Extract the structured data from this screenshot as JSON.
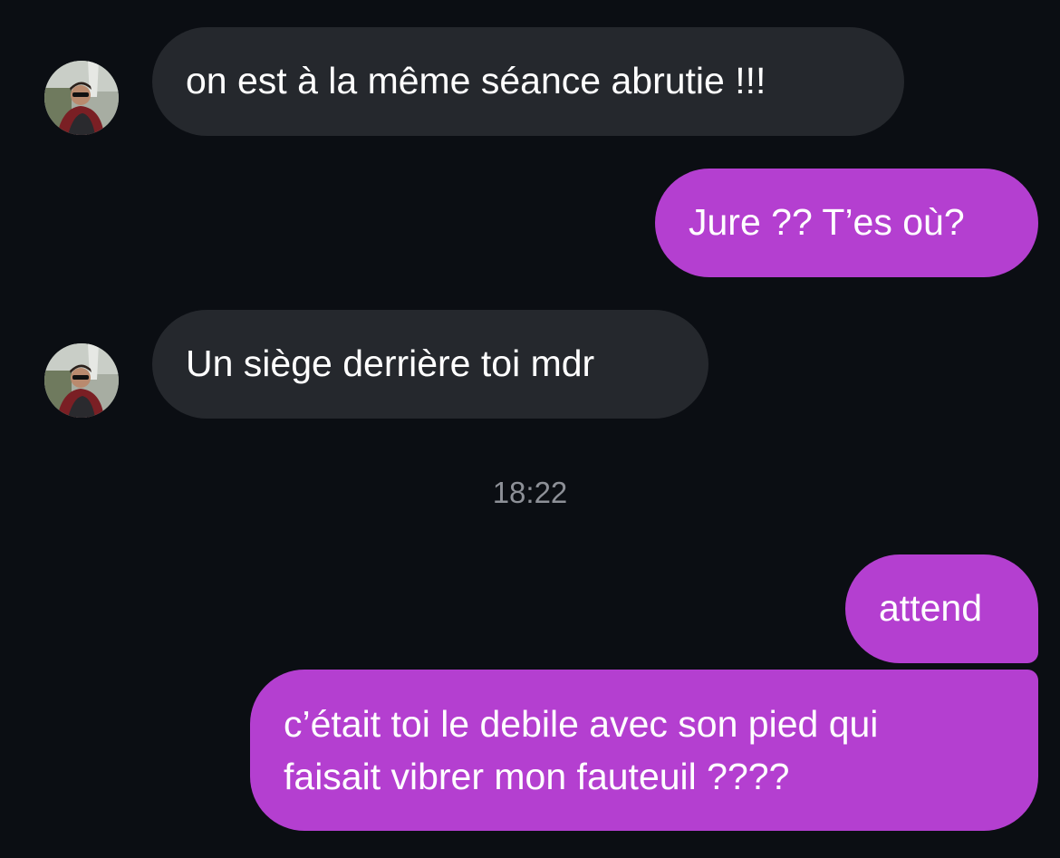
{
  "conversation": {
    "messages": [
      {
        "direction": "incoming",
        "text": "on est à la même séance abrutie !!!"
      },
      {
        "direction": "outgoing",
        "text": "Jure ?? T’es où?"
      },
      {
        "direction": "incoming",
        "text": "Un siège derrière toi mdr"
      },
      {
        "direction": "outgoing",
        "text": "attend"
      },
      {
        "direction": "outgoing",
        "lines": [
          "c’était toi le debile avec son pied qui",
          "faisait vibrer mon fauteuil ????"
        ]
      }
    ],
    "timestamp": "18:22"
  },
  "colors": {
    "background": "#0b0e13",
    "incoming_bubble": "#25282d",
    "outgoing_bubble": "#b43fd0",
    "timestamp_text": "#8d9097"
  },
  "icons": {
    "contact_avatar": "avatar-photo"
  }
}
